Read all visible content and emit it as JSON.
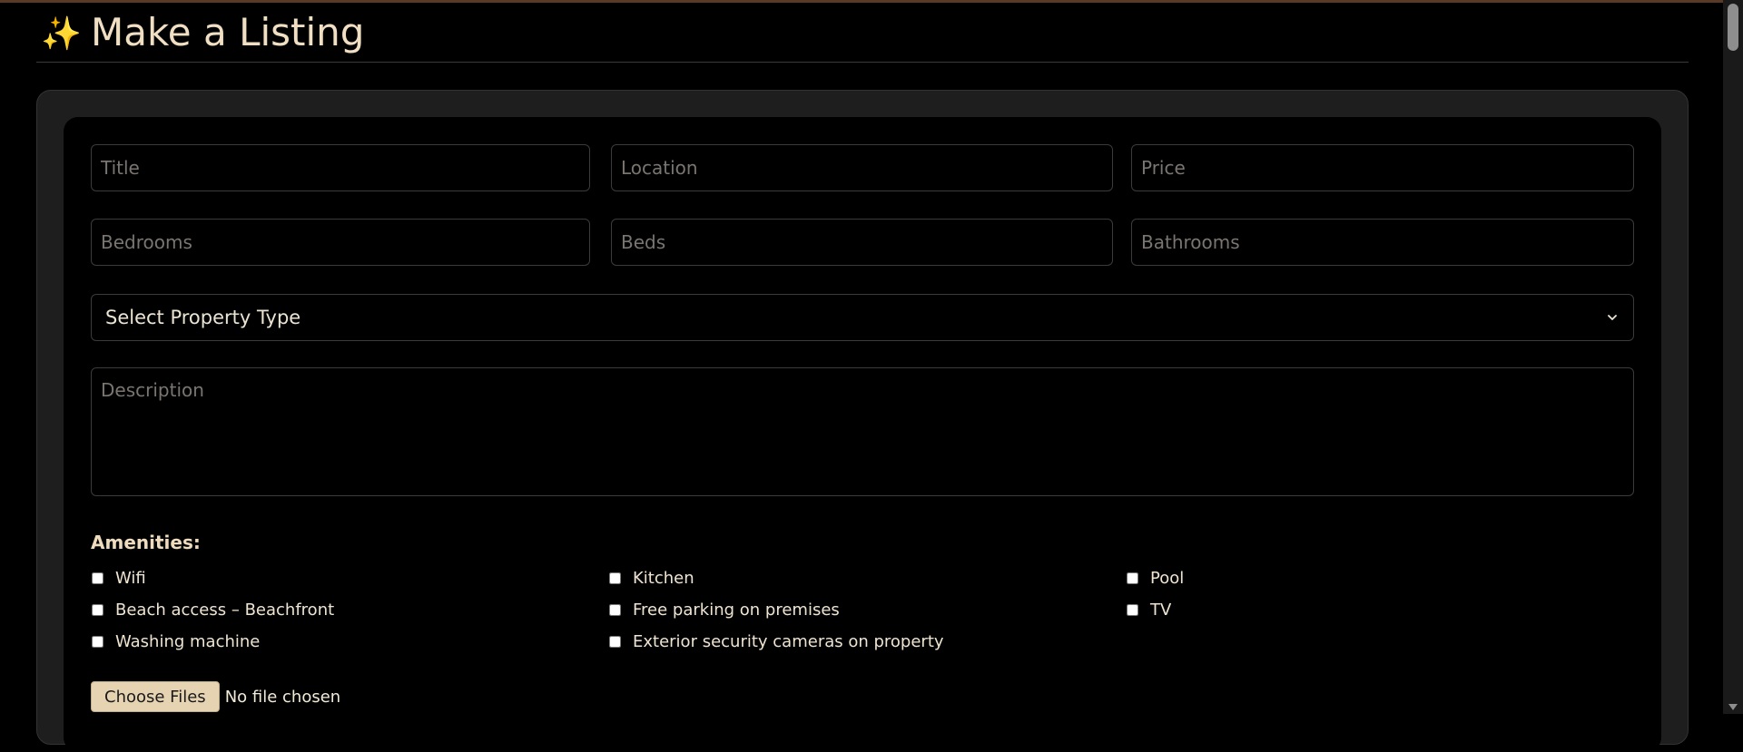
{
  "header": {
    "icon": "sparkles-icon",
    "icon_glyph": "✨",
    "title": "Make a Listing"
  },
  "form": {
    "title_placeholder": "Title",
    "location_placeholder": "Location",
    "price_placeholder": "Price",
    "bedrooms_placeholder": "Bedrooms",
    "beds_placeholder": "Beds",
    "bathrooms_placeholder": "Bathrooms",
    "property_type_selected": "Select Property Type",
    "description_placeholder": "Description",
    "amenities_label": "Amenities:",
    "amenities": [
      {
        "label": "Wifi",
        "checked": false
      },
      {
        "label": "Kitchen",
        "checked": false
      },
      {
        "label": "Pool",
        "checked": false
      },
      {
        "label": "Beach access – Beachfront",
        "checked": false
      },
      {
        "label": "Free parking on premises",
        "checked": false
      },
      {
        "label": "TV",
        "checked": false
      },
      {
        "label": "Washing machine",
        "checked": false
      },
      {
        "label": "Exterior security cameras on property",
        "checked": false
      }
    ],
    "choose_files_label": "Choose Files",
    "file_status": "No file chosen"
  },
  "colors": {
    "accent": "#f1dfc4",
    "background": "#000000",
    "card": "#1e1e1e",
    "button": "#e6d3b2"
  }
}
